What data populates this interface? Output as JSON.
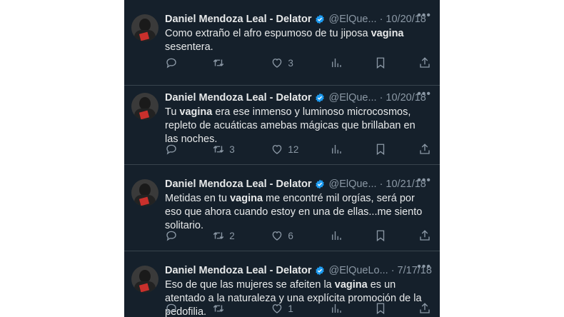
{
  "author": {
    "name": "Daniel Mendoza Leal - Delator",
    "verified_color": "#1d9bf0"
  },
  "tweets": [
    {
      "handle": "@ElQue...",
      "date": "10/20/18",
      "text_parts": [
        "Como extraño el afro espumoso de tu jiposa ",
        "vagina",
        " sesentera."
      ],
      "replies": "",
      "retweets": "",
      "likes": "3"
    },
    {
      "handle": "@ElQue...",
      "date": "10/20/18",
      "text_parts": [
        "Tu ",
        "vagina",
        " era ese inmenso y luminoso microcosmos, repleto de acuáticas amebas mágicas que brillaban en las noches."
      ],
      "replies": "",
      "retweets": "3",
      "likes": "12"
    },
    {
      "handle": "@ElQue...",
      "date": "10/21/18",
      "text_parts": [
        "Metidas en tu ",
        "vagina",
        " me encontré mil orgías, será por eso que ahora cuando estoy en una de ellas...me siento solitario."
      ],
      "replies": "",
      "retweets": "2",
      "likes": "6"
    },
    {
      "handle": "@ElQueLo...",
      "date": "7/17/18",
      "text_parts": [
        "Eso de que las mujeres se afeiten la ",
        "vagina",
        " es un atentado a la naturaleza y una explícita promoción de la pedofilia."
      ],
      "replies": "",
      "retweets": "",
      "likes": "1"
    }
  ],
  "icons": [
    "reply-icon",
    "retweet-icon",
    "like-icon",
    "views-icon",
    "bookmark-icon",
    "share-icon",
    "more-icon",
    "verified-icon"
  ]
}
